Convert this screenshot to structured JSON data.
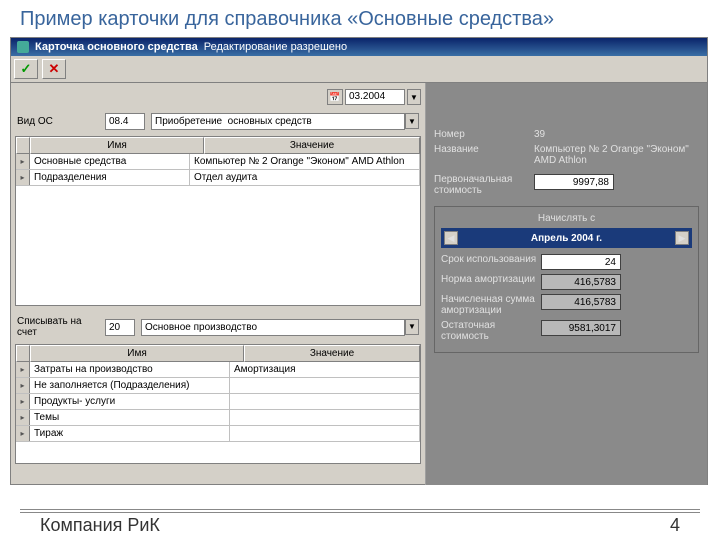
{
  "slide": {
    "title": "Пример карточки для справочника «Основные средства»",
    "footer_company": "Компания РиК",
    "footer_page": "4"
  },
  "titlebar": {
    "app": "Карточка основного средства",
    "mode": "Редактирование разрешено"
  },
  "date": {
    "value": "03.2004"
  },
  "form": {
    "vid_os_label": "Вид ОС",
    "vid_os_code": "08.4",
    "vid_os_value": "Приобретение  основных средств",
    "writeoff_label": "Списывать на счет",
    "writeoff_code": "20",
    "writeoff_value": "Основное производство"
  },
  "grid1": {
    "h1": "Имя",
    "h2": "Значение",
    "rows": [
      {
        "name": "Основные средства",
        "value": "Компьютер № 2 Orange \"Эконом\" AMD Athlon"
      },
      {
        "name": "Подразделения",
        "value": "Отдел аудита"
      }
    ]
  },
  "grid2": {
    "h1": "Имя",
    "h2": "Значение",
    "rows": [
      {
        "name": "Затраты на производство",
        "value": "Амортизация"
      },
      {
        "name": "Не заполняется (Подразделения)",
        "value": ""
      },
      {
        "name": "Продукты- услуги",
        "value": ""
      },
      {
        "name": "Темы",
        "value": ""
      },
      {
        "name": "Тираж",
        "value": ""
      }
    ]
  },
  "right": {
    "number_label": "Номер",
    "number_value": "39",
    "name_label": "Название",
    "name_value": "Компьютер № 2 Orange \"Эконом\" AMD Athlon",
    "initcost_label": "Первоначальная стоимость",
    "initcost_value": "9997,88",
    "accrue_title": "Начислять с",
    "month": "Апрель 2004 г.",
    "usage_label": "Срок использования",
    "usage_value": "24",
    "rate_label": "Норма амортизации",
    "rate_value": "416,5783",
    "accrued_label": "Начисленная сумма амортизации",
    "accrued_value": "416,5783",
    "residual_label": "Остаточная стоимость",
    "residual_value": "9581,3017"
  }
}
